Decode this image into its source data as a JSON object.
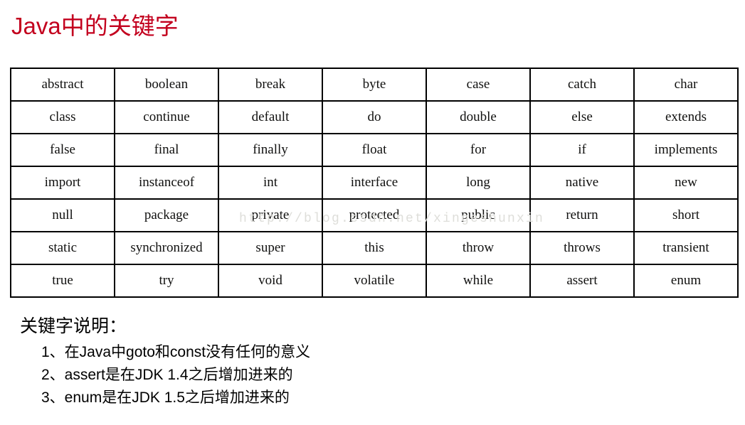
{
  "page": {
    "title": "Java中的关键字",
    "title_color": "#c3001e",
    "background_color": "#ffffff"
  },
  "watermark": {
    "text": "http://blog.csdn.net/xingeshunxin",
    "color": "#dededa"
  },
  "keyword_table": {
    "rows": 7,
    "columns": 7,
    "border_color": "#000000",
    "cells": [
      [
        "abstract",
        "boolean",
        "break",
        "byte",
        "case",
        "catch",
        "char"
      ],
      [
        "class",
        "continue",
        "default",
        "do",
        "double",
        "else",
        "extends"
      ],
      [
        "false",
        "final",
        "finally",
        "float",
        "for",
        "if",
        "implements"
      ],
      [
        "import",
        "instanceof",
        "int",
        "interface",
        "long",
        "native",
        "new"
      ],
      [
        "null",
        "package",
        "private",
        "protected",
        "public",
        "return",
        "short"
      ],
      [
        "static",
        "synchronized",
        "super",
        "this",
        "throw",
        "throws",
        "transient"
      ],
      [
        "true",
        "try",
        "void",
        "volatile",
        "while",
        "assert",
        "enum"
      ]
    ]
  },
  "notes": {
    "heading": "关键字说明：",
    "items": [
      "1、在Java中goto和const没有任何的意义",
      "2、assert是在JDK 1.4之后增加进来的",
      "3、enum是在JDK 1.5之后增加进来的"
    ]
  }
}
